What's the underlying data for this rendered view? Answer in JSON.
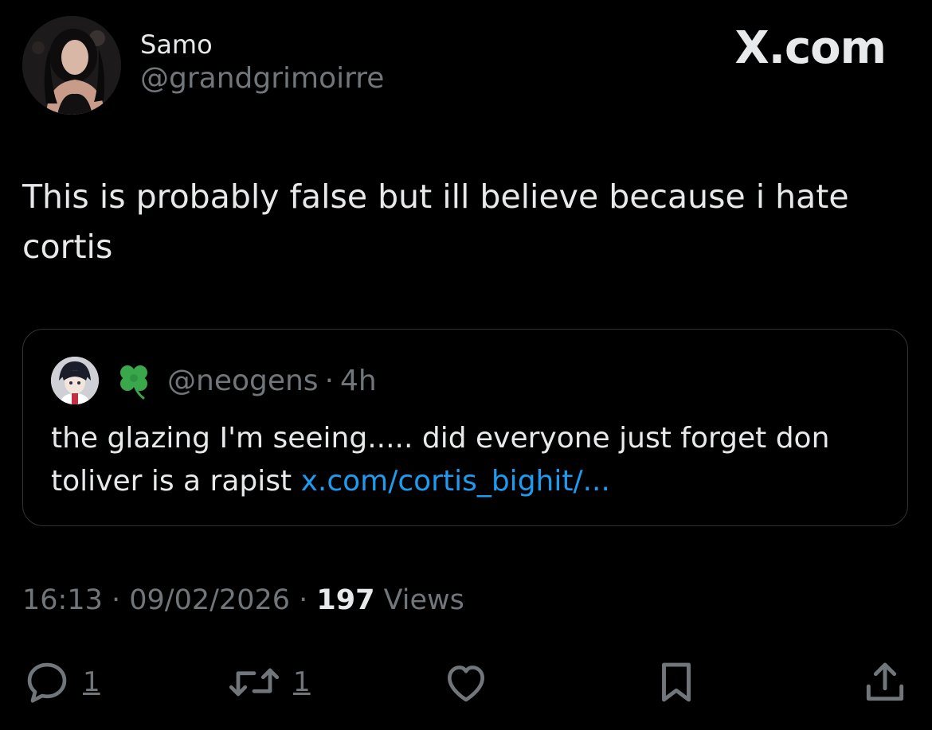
{
  "author": {
    "display_name": "Samo",
    "handle": "@grandgrimoirre"
  },
  "brand": "X.com",
  "tweet": {
    "text": "This is probably false but ill believe because i hate cortis"
  },
  "quote": {
    "handle": "@neogens",
    "separator": "·",
    "time": "4h",
    "text": "the glazing I'm seeing..... did everyone just forget don toliver is a rapist ",
    "link": "x.com/cortis_bighit/..."
  },
  "meta": {
    "time": "16:13",
    "sep1": " · ",
    "date": "09/02/2026",
    "sep2": " · ",
    "views_count": "197",
    "views_label": " Views"
  },
  "actions": {
    "reply_count": "1",
    "retweet_count": "1"
  },
  "colors": {
    "background": "#000000",
    "text_primary": "#e7e9ea",
    "text_secondary": "#71767b",
    "link": "#1d9bf0",
    "border": "#2f3336",
    "clover": "#3aa84a"
  },
  "icons": {
    "reply": "speech-bubble-icon",
    "retweet": "retweet-arrows-icon",
    "like": "heart-icon",
    "bookmark": "bookmark-icon",
    "share": "share-upload-icon",
    "clover": "four-leaf-clover-icon"
  }
}
